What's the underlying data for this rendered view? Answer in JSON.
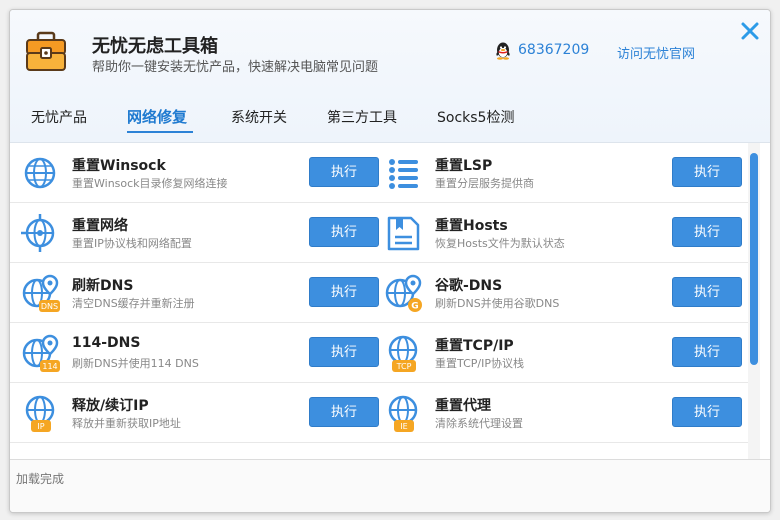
{
  "app": {
    "title": "无忧无虑工具箱",
    "subtitle": "帮助你一键安装无忧产品，快速解决电脑常见问题",
    "qq_number": "68367209",
    "site_link": "访问无忧官网"
  },
  "tabs": [
    {
      "label": "无忧产品",
      "active": false
    },
    {
      "label": "网络修复",
      "active": true
    },
    {
      "label": "系统开关",
      "active": false
    },
    {
      "label": "第三方工具",
      "active": false
    },
    {
      "label": "Socks5检测",
      "active": false
    }
  ],
  "tools": [
    {
      "title": "重置Winsock",
      "desc": "重置Winsock目录修复网络连接",
      "icon": "globe-icon",
      "badge": "",
      "button": "执行"
    },
    {
      "title": "重置LSP",
      "desc": "重置分层服务提供商",
      "icon": "layers-list-icon",
      "badge": "",
      "button": "执行"
    },
    {
      "title": "重置网络",
      "desc": "重置IP协议栈和网络配置",
      "icon": "network-globe-icon",
      "badge": "",
      "button": "执行"
    },
    {
      "title": "重置Hosts",
      "desc": "恢复Hosts文件为默认状态",
      "icon": "hosts-file-icon",
      "badge": "",
      "button": "执行"
    },
    {
      "title": "刷新DNS",
      "desc": "清空DNS缓存并重新注册",
      "icon": "globe-pin-icon",
      "badge": "DNS",
      "button": "执行"
    },
    {
      "title": "谷歌-DNS",
      "desc": "刷新DNS并使用谷歌DNS",
      "icon": "globe-pin-icon",
      "badge": "G",
      "button": "执行"
    },
    {
      "title": "114-DNS",
      "desc": "刷新DNS并使用114 DNS",
      "icon": "globe-pin-icon",
      "badge": "114",
      "button": "执行"
    },
    {
      "title": "重置TCP/IP",
      "desc": "重置TCP/IP协议栈",
      "icon": "globe-badge-icon",
      "badge": "TCP",
      "button": "执行"
    },
    {
      "title": "释放/续订IP",
      "desc": "释放并重新获取IP地址",
      "icon": "globe-badge-icon",
      "badge": "IP",
      "button": "执行"
    },
    {
      "title": "重置代理",
      "desc": "清除系统代理设置",
      "icon": "globe-badge-icon",
      "badge": "IE",
      "button": "执行"
    }
  ],
  "status": {
    "text": "加载完成"
  },
  "colors": {
    "accent": "#2c82d6",
    "button": "#3d8fdf",
    "badge": "#f5a623",
    "close": "#2c9be8"
  }
}
